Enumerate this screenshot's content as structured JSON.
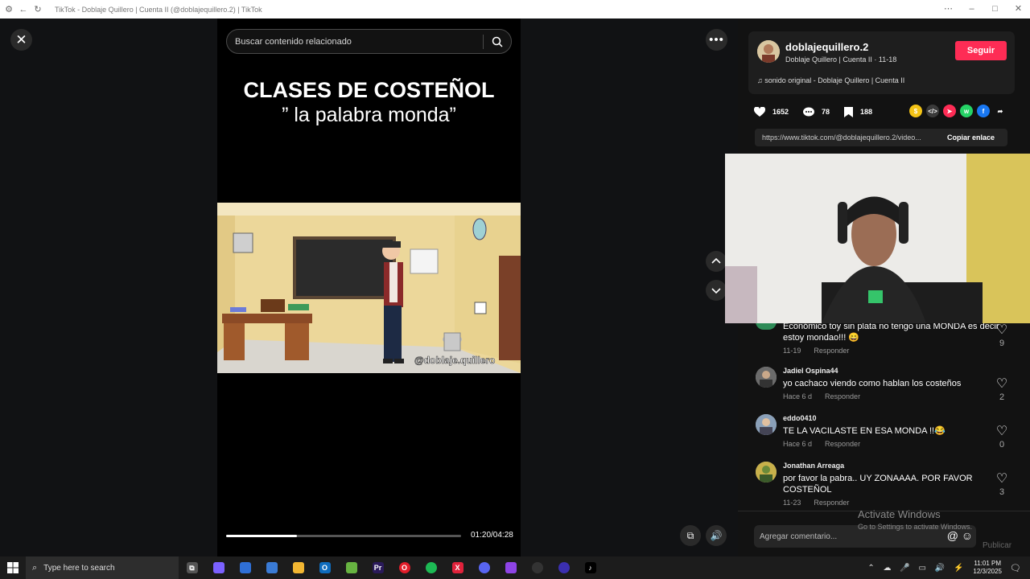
{
  "window": {
    "title": "TikTok - Doblaje Quillero | Cuenta II (@doblajequillero.2) | TikTok"
  },
  "search": {
    "placeholder": "Buscar contenido relacionado"
  },
  "video": {
    "title_line1": "CLASES DE COSTEÑOL",
    "title_line2": "” la palabra monda”",
    "watermark": "@doblaje.quillero",
    "time": "01:20/04:28",
    "progress": 0.3
  },
  "author": {
    "username": "doblajequillero.2",
    "subtitle": "Doblaje Quillero | Cuenta II · 11-18",
    "music": "sonido original - Doblaje Quillero | Cuenta II",
    "follow_label": "Seguir"
  },
  "stats": {
    "likes": "1652",
    "comments": "78",
    "saves": "188"
  },
  "share": {
    "url": "https://www.tiktok.com/@doblajequillero.2/video...",
    "copy_label": "Copiar enlace"
  },
  "comments": [
    {
      "user": "",
      "text": "Económico toy sin plata no tengo una MONDA es decir estoy mondao!!! 😄",
      "time": "11-19",
      "reply": "Responder",
      "likes": "9"
    },
    {
      "user": "Jadiel Ospina44",
      "text": "yo cachaco viendo como hablan los costeños",
      "time": "Hace 6 d",
      "reply": "Responder",
      "likes": "2"
    },
    {
      "user": "eddo0410",
      "text": "TE LA VACILASTE EN ESA MONDA !!😂",
      "time": "Hace 6 d",
      "reply": "Responder",
      "likes": "0"
    },
    {
      "user": "Jonathan Arreaga",
      "text": "por favor la pabra.. UY ZONAAAA. POR FAVOR COSTEÑOL",
      "time": "11-23",
      "reply": "Responder",
      "likes": "3"
    }
  ],
  "comment_box": {
    "placeholder": "Agregar comentario...",
    "publish_label": "Publicar"
  },
  "activation": {
    "title": "Activate Windows",
    "subtitle": "Go to Settings to activate Windows."
  },
  "taskbar": {
    "search_placeholder": "Type here to search",
    "time": "11:01 PM",
    "date": "12/3/2025"
  },
  "colors": {
    "accent": "#fe2c55",
    "background": "#121212"
  },
  "icons": [
    "close-icon",
    "more-icon",
    "search-icon",
    "chevron-up-icon",
    "chevron-down-icon",
    "heart-icon",
    "comment-icon",
    "bookmark-icon",
    "volume-icon",
    "music-note-icon"
  ]
}
